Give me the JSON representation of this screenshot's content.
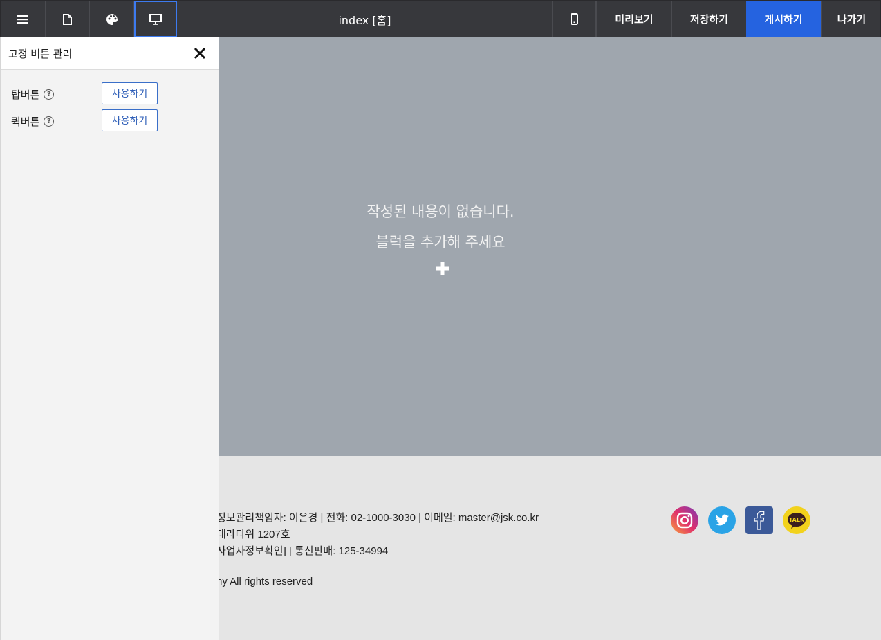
{
  "topbar": {
    "page_title": "index [홈]",
    "preview_label": "미리보기",
    "save_label": "저장하기",
    "publish_label": "게시하기",
    "exit_label": "나가기"
  },
  "panel": {
    "title": "고정 버튼 관리",
    "options": [
      {
        "label": "탑버튼",
        "button": "사용하기"
      },
      {
        "label": "퀵버튼",
        "button": "사용하기"
      }
    ],
    "help_glyph": "?"
  },
  "canvas": {
    "empty_line1": "작성된 내용이 없습니다.",
    "empty_line2": "블럭을 추가해 주세요"
  },
  "footer": {
    "line1": "정보관리책임자: 이은경 | 전화: 02-1000-3030 | 이메일: master@jsk.co.kr",
    "line2": " 태라타워 1207호",
    "line3": "사업자정보확인] | 통신판매: 125-34994",
    "line4": "ny All rights reserved"
  },
  "colors": {
    "topbar_bg": "#37383c",
    "publish_bg": "#2563e0",
    "canvas_bg": "#9fa6ae",
    "footer_bg": "#e5e5e5"
  },
  "icons": [
    "menu-icon",
    "page-icon",
    "palette-icon",
    "desktop-icon",
    "mobile-icon",
    "close-icon",
    "help-icon",
    "plus-icon",
    "instagram-icon",
    "twitter-icon",
    "facebook-icon",
    "kakaotalk-icon"
  ]
}
